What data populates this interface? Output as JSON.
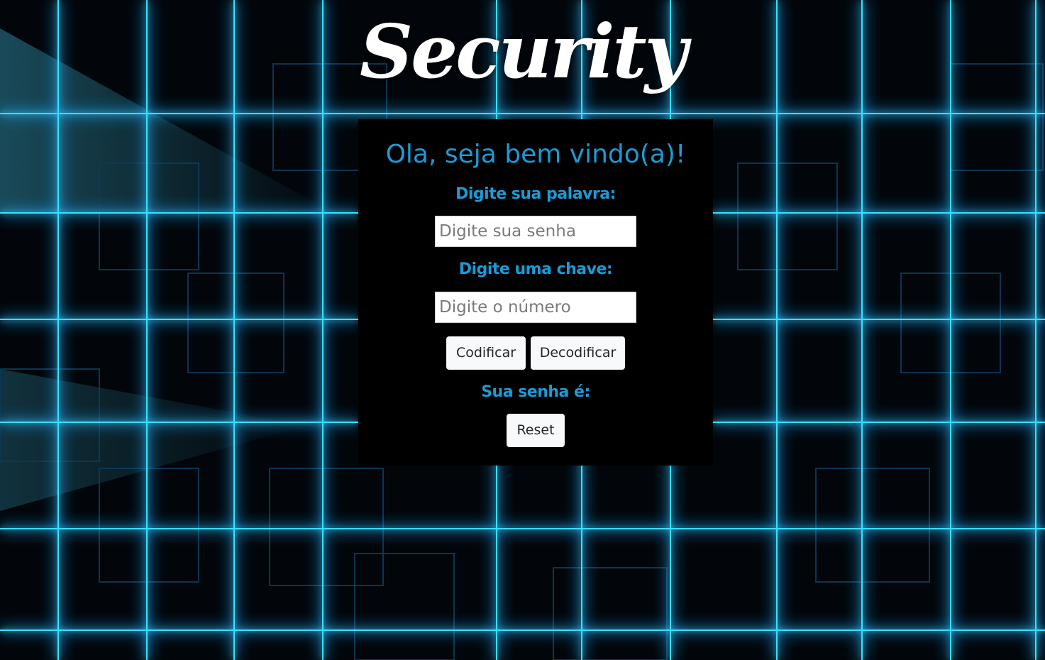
{
  "brand": {
    "logo_text": "Security"
  },
  "form": {
    "welcome": "Ola, seja bem vindo(a)!",
    "word_label": "Digite sua palavra:",
    "word_placeholder": "Digite sua senha",
    "key_label": "Digite uma chave:",
    "key_placeholder": "Digite o número",
    "encode_label": "Codificar",
    "decode_label": "Decodificar",
    "result_label": "Sua senha é:",
    "reset_label": "Reset"
  },
  "colors": {
    "accent": "#1b9bd6",
    "panel_bg": "#000000",
    "button_bg": "#f8f9fa",
    "grid_glow": "#2fd6ff"
  }
}
